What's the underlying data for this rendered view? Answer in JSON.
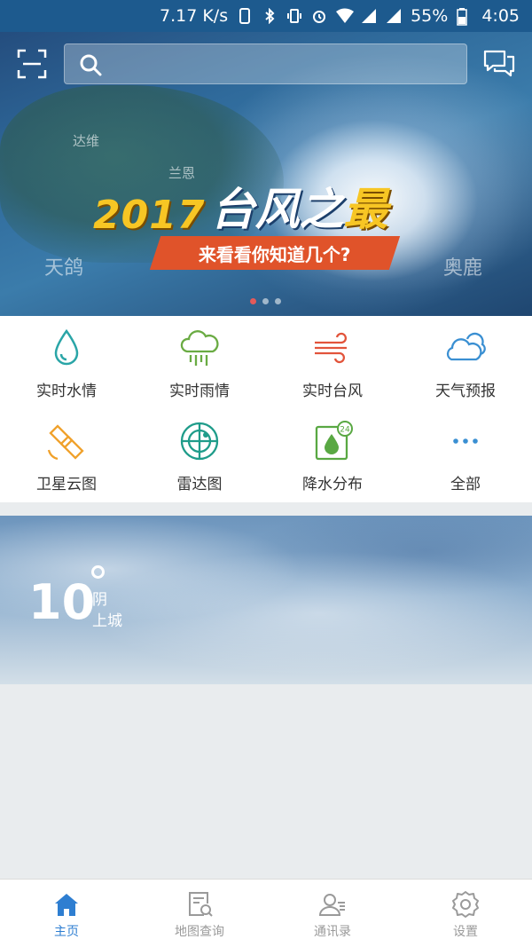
{
  "status_bar": {
    "net_speed": "7.17 K/s",
    "battery": "55%",
    "time": "4:05",
    "icons": [
      "phone-icon",
      "bluetooth-icon",
      "vibrate-icon",
      "alarm-icon",
      "wifi-icon",
      "signal-icon",
      "signal-icon",
      "battery-icon"
    ]
  },
  "topbar": {
    "scan_icon": "scan-icon",
    "search_icon": "search-icon",
    "search_value": "",
    "message_icon": "message-icon"
  },
  "banner": {
    "year": "2017",
    "headline_main": "台风之",
    "headline_accent": "最",
    "subtitle": "来看看你知道几个?",
    "places": [
      "达维",
      "兰恩",
      "天鸽",
      "奥鹿"
    ],
    "slide_count": 3,
    "active_slide": 1
  },
  "grid": {
    "items": [
      {
        "label": "实时水情",
        "icon": "water-drop-icon",
        "color": "#2aa5a7"
      },
      {
        "label": "实时雨情",
        "icon": "rain-cloud-icon",
        "color": "#6aab43"
      },
      {
        "label": "实时台风",
        "icon": "wind-icon",
        "color": "#e2543b"
      },
      {
        "label": "天气预报",
        "icon": "cloud-icon",
        "color": "#3a8fd2"
      },
      {
        "label": "卫星云图",
        "icon": "satellite-icon",
        "color": "#f0a12b"
      },
      {
        "label": "雷达图",
        "icon": "radar-icon",
        "color": "#1f9c8a"
      },
      {
        "label": "降水分布",
        "icon": "rain-distribution-icon",
        "color": "#59a843"
      },
      {
        "label": "全部",
        "icon": "more-icon",
        "color": "#3a8fd2"
      }
    ]
  },
  "weather": {
    "temperature": "10",
    "condition": "阴",
    "location": "上城"
  },
  "bottom_nav": {
    "items": [
      {
        "label": "主页",
        "icon": "home-icon",
        "active": true
      },
      {
        "label": "地图查询",
        "icon": "map-search-icon",
        "active": false
      },
      {
        "label": "通讯录",
        "icon": "contacts-icon",
        "active": false
      },
      {
        "label": "设置",
        "icon": "settings-icon",
        "active": false
      }
    ],
    "active_color": "#2e7ed1",
    "inactive_color": "#9a9a9a"
  }
}
